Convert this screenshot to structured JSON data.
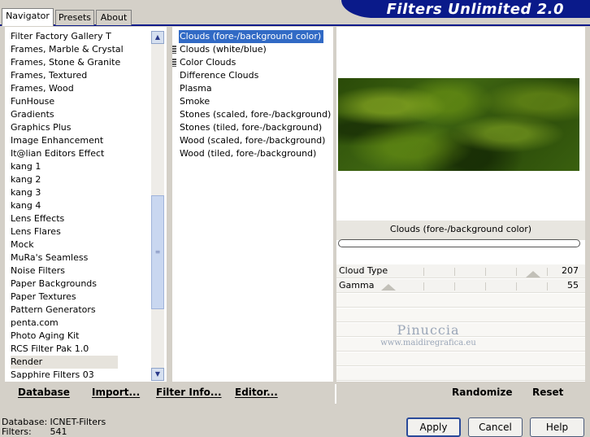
{
  "header": {
    "title": "Filters Unlimited 2.0"
  },
  "tabs": [
    {
      "label": "Navigator"
    },
    {
      "label": "Presets"
    },
    {
      "label": "About"
    }
  ],
  "categories": [
    "Filter Factory Gallery T",
    "Frames, Marble & Crystal",
    "Frames, Stone & Granite",
    "Frames, Textured",
    "Frames, Wood",
    "FunHouse",
    "Gradients",
    "Graphics Plus",
    "Image Enhancement",
    "It@lian Editors Effect",
    "kang 1",
    "kang 2",
    "kang 3",
    "kang 4",
    "Lens Effects",
    "Lens Flares",
    "Mock",
    "MuRa's Seamless",
    "Noise Filters",
    "Paper Backgrounds",
    "Paper Textures",
    "Pattern Generators",
    "penta.com",
    "Photo Aging Kit",
    "RCS Filter Pak 1.0",
    "Render",
    "Sapphire Filters 03"
  ],
  "filters": [
    "Clouds (fore-/background color)",
    "Clouds (white/blue)",
    "Color Clouds",
    "Difference Clouds",
    "Plasma",
    "Smoke",
    "Stones (scaled, fore-/background)",
    "Stones (tiled, fore-/background)",
    "Wood (scaled, fore-/background)",
    "Wood (tiled, fore-/background)"
  ],
  "preview": {
    "caption": "Clouds (fore-/background color)",
    "params": [
      {
        "name": "Cloud Type",
        "value": "207"
      },
      {
        "name": "Gamma",
        "value": "55"
      }
    ]
  },
  "watermark": {
    "title": "Pinuccia",
    "url": "www.maidiregrafica.eu"
  },
  "toolbar": {
    "database": "Database",
    "import": "Import...",
    "filter_info": "Filter Info...",
    "editor": "Editor...",
    "randomize": "Randomize",
    "reset": "Reset"
  },
  "status": {
    "database_label": "Database:",
    "database_value": "ICNET-Filters",
    "filters_label": "Filters:",
    "filters_value": "541"
  },
  "buttons": {
    "apply": "Apply",
    "cancel": "Cancel",
    "help": "Help"
  }
}
